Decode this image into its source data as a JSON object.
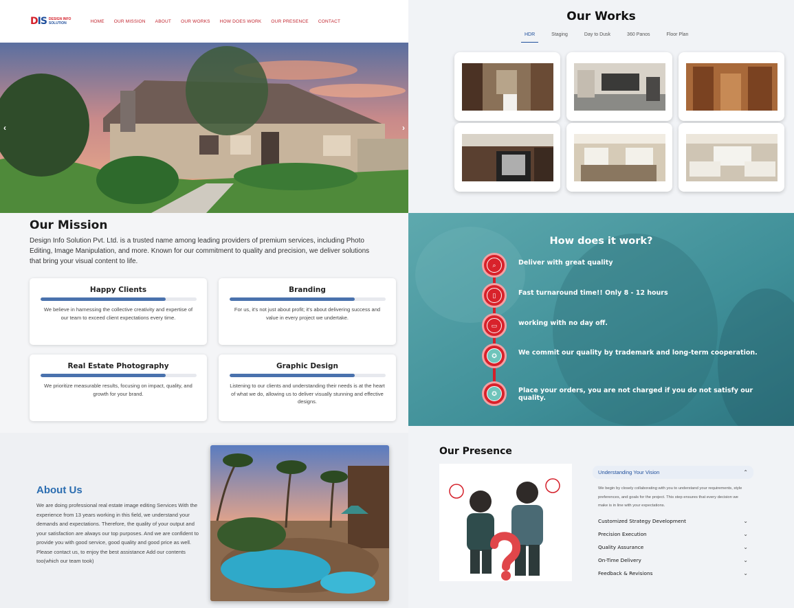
{
  "header": {
    "logo_mark_a": "D",
    "logo_mark_b": "IS",
    "logo_line1": "DESIGN INFO",
    "logo_line2": "SOLUTION",
    "nav": [
      "HOME",
      "OUR MISSION",
      "ABOUT",
      "OUR WORKS",
      "HOW DOES WORK",
      "OUR PRESENCE",
      "CONTACT"
    ]
  },
  "hero": {
    "prev_arrow": "‹",
    "next_arrow": "›"
  },
  "works": {
    "title": "Our Works",
    "tabs": [
      "HDR",
      "Staging",
      "Day to Dusk",
      "360 Panos",
      "Floor Plan"
    ],
    "active_tab": "HDR"
  },
  "mission": {
    "title": "Our Mission",
    "description": "Design Info Solution Pvt. Ltd. is a trusted name among leading providers of premium services, including Photo Editing, Image Manipulation, and more. Known for our commitment to quality and precision, we deliver solutions that bring your visual content to life.",
    "cards": [
      {
        "title": "Happy Clients",
        "progress": 0.8,
        "text": "We believe in harnessing the collective creativity and expertise of our team to exceed client expectations every time."
      },
      {
        "title": "Branding",
        "progress": 0.8,
        "text": "For us, it's not just about profit; it's about delivering success and value in every project we undertake."
      },
      {
        "title": "Real Estate Photography",
        "progress": 0.8,
        "text": "We prioritize measurable results, focusing on impact, quality, and growth for your brand."
      },
      {
        "title": "Graphic Design",
        "progress": 0.8,
        "text": "Listening to our clients and understanding their needs is at the heart of what we do, allowing us to deliver visually stunning and effective designs."
      }
    ]
  },
  "how": {
    "title": "How does it work?",
    "steps": [
      {
        "icon": "search-icon",
        "text": "Deliver with great quality"
      },
      {
        "icon": "bookmark-icon",
        "text": "Fast turnaround time!! Only 8 - 12 hours"
      },
      {
        "icon": "book-icon",
        "text": "working with no day off."
      },
      {
        "icon": "award-icon",
        "text": "We commit our quality by trademark and long-term cooperation."
      },
      {
        "icon": "award-icon",
        "text": "Place your orders, you are not charged if you do not satisfy our quality."
      }
    ]
  },
  "about": {
    "title": "About Us",
    "text": "We are doing professional real estate image editing Services With the experience from 13 years working in this field, we understand your demands and expectations. Therefore, the quality of your output and your satisfaction are always our top purposes. And we are confident to provide you with good service, good quality and good price as well. Please contact us, to enjoy the best assistance Add our contents too(which our team took)"
  },
  "presence": {
    "title": "Our Presence",
    "accordion_open": {
      "title": "Understanding Your Vision",
      "body": "We begin by closely collaborating with you to understand your requirements, style preferences, and goals for the project. This step ensures that every decision we make is in line with your expectations."
    },
    "accordion_items": [
      "Customized Strategy Development",
      "Precision Execution",
      "Quality Assurance",
      "On-Time Delivery",
      "Feedback & Revisions"
    ]
  },
  "colors": {
    "brand_red": "#d4202a",
    "brand_blue": "#1f4f9c",
    "teal": "#3f9aa3"
  }
}
